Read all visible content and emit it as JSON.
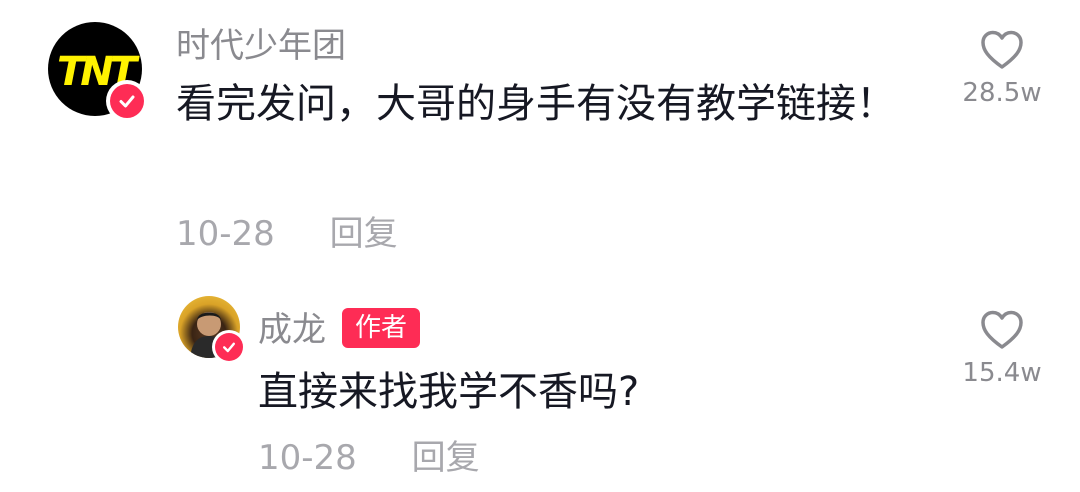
{
  "comments": [
    {
      "user": "时代少年团",
      "avatar": "TNT",
      "verified": true,
      "text": "看完发问，大哥的身手有没有教学链接！",
      "date": "10-28",
      "reply_label": "回复",
      "likes": "28.5w"
    },
    {
      "user": "成龙",
      "author_tag": "作者",
      "verified": true,
      "text": "直接来找我学不香吗?",
      "date": "10-28",
      "reply_label": "回复",
      "likes": "15.4w"
    }
  ],
  "colors": {
    "accent": "#fe2c55",
    "text_primary": "#161823",
    "text_secondary": "#8a8a8f",
    "brand_tnt": "#fff200"
  },
  "icons": [
    "heart-icon",
    "verified-badge-icon"
  ]
}
